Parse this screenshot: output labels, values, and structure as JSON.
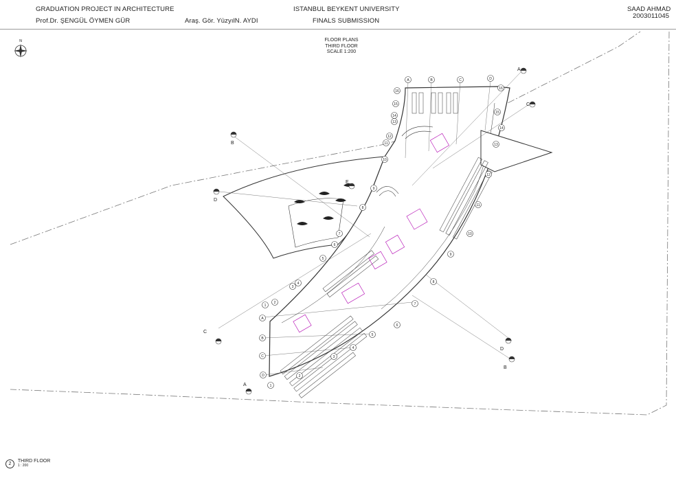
{
  "header": {
    "project": "GRADUATION PROJECT IN ARCHITECTURE",
    "professor": "Prof.Dr. ŞENGÜL ÖYMEN GÜR",
    "assistant": "Araş. Gör. YüzyılN. AYDI",
    "university": "ISTANBUL BEYKENT UNIVERSITY",
    "submission": "FINALS SUBMISSION",
    "student_name": "SAAD AHMAD",
    "student_id": "2003011045"
  },
  "drawing": {
    "title_line1": "FLOOR PLANS",
    "title_line2": "THIRD FLOOR",
    "title_line3": "SCALE 1:200",
    "north_label": "N"
  },
  "footer": {
    "view_number": "2",
    "view_name": "THIRD FLOOR",
    "view_scale": "1 : 200"
  },
  "grid_bubbles": {
    "column_labels": [
      "A",
      "B",
      "C",
      "D"
    ],
    "row_labels": [
      "1",
      "2",
      "3",
      "4",
      "5",
      "6",
      "7",
      "8",
      "9",
      "10",
      "11",
      "12",
      "13",
      "14",
      "15",
      "16"
    ]
  },
  "section_markers": [
    "A",
    "B",
    "C",
    "D",
    "E"
  ],
  "colors": {
    "line": "#333333",
    "accent": "#b000b0",
    "dash": "#777777"
  }
}
